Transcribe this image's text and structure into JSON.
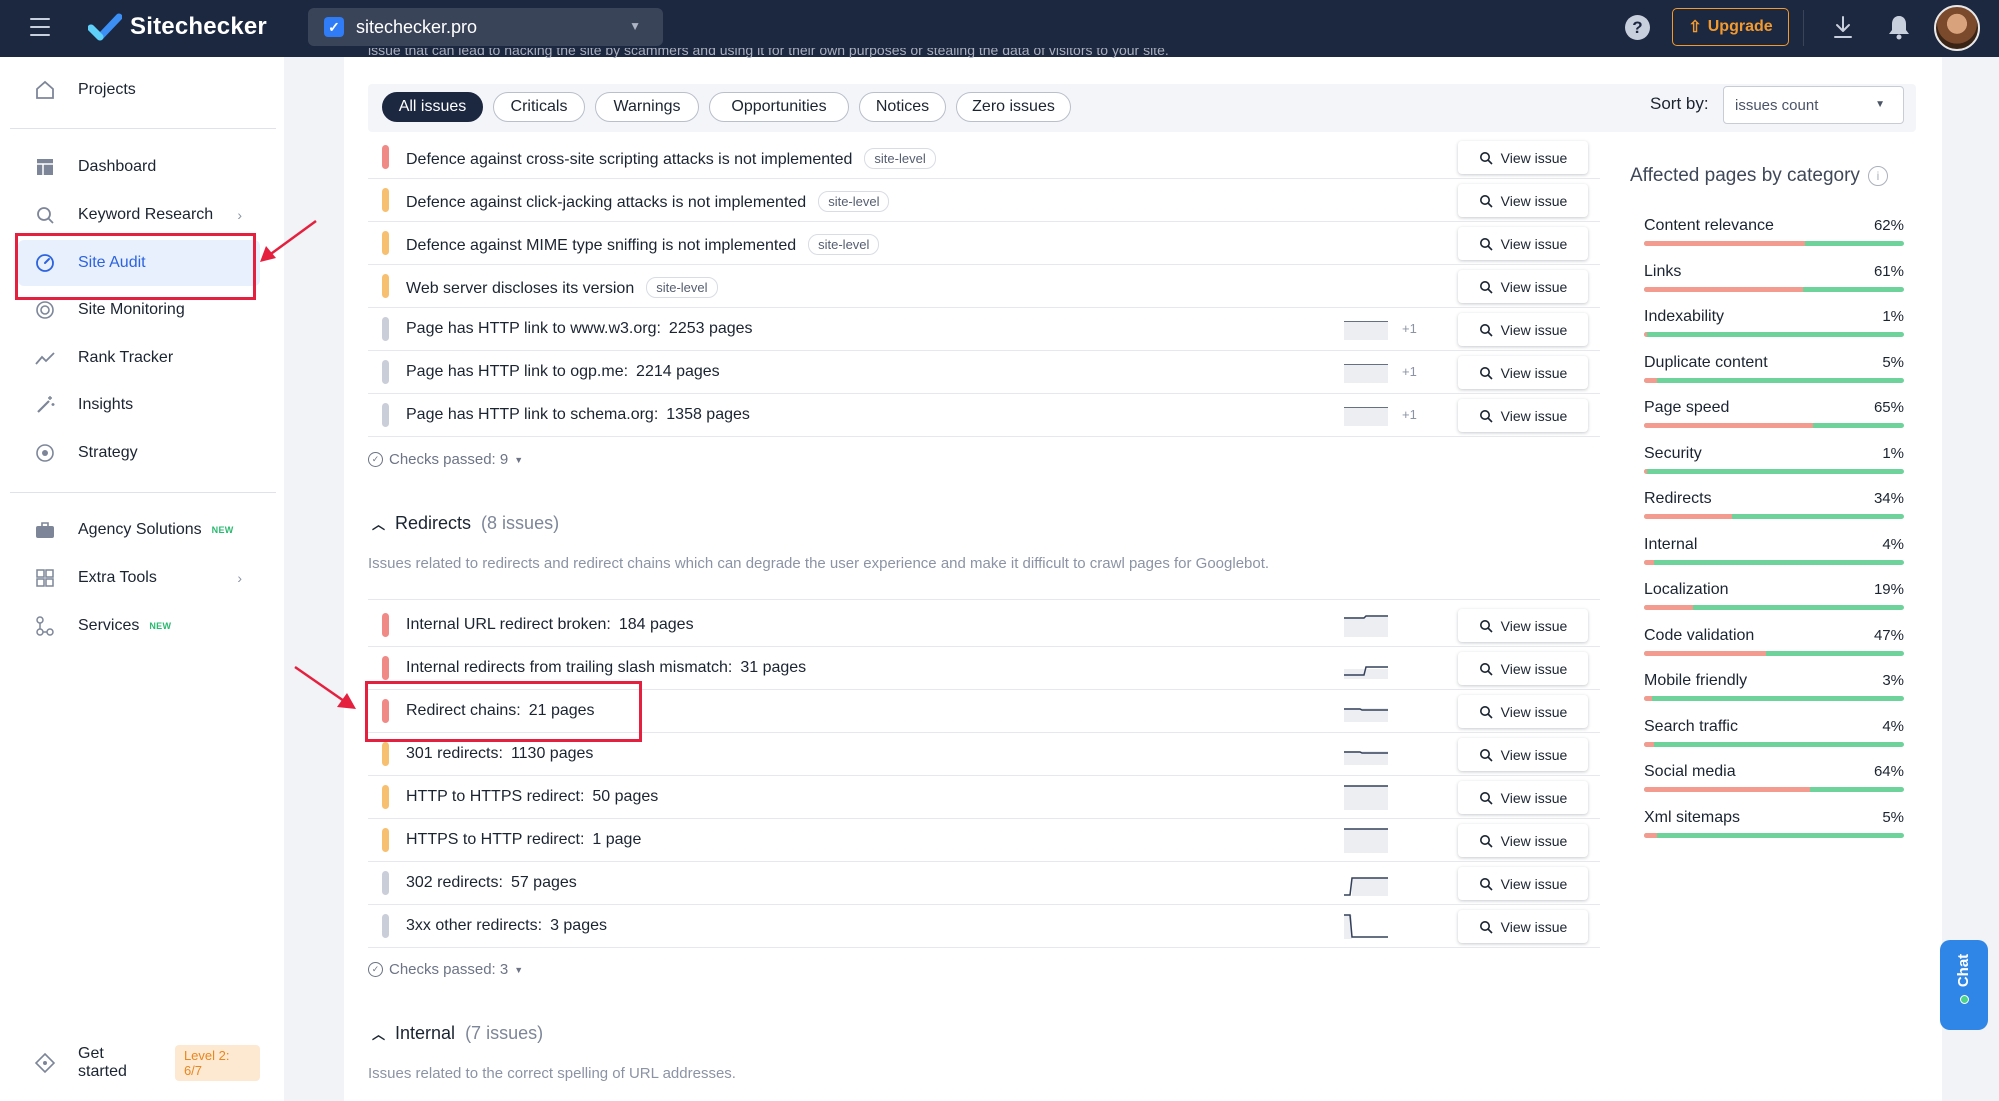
{
  "app": {
    "name": "Sitechecker",
    "project": "sitechecker.pro",
    "upgrade_label": "Upgrade"
  },
  "sidebar": {
    "items": [
      {
        "label": "Projects",
        "icon": "home-icon"
      },
      {
        "label": "Dashboard",
        "icon": "dashboard-icon"
      },
      {
        "label": "Keyword Research",
        "icon": "keyword-icon"
      },
      {
        "label": "Site Audit",
        "icon": "audit-icon"
      },
      {
        "label": "Site Monitoring",
        "icon": "monitoring-icon"
      },
      {
        "label": "Rank Tracker",
        "icon": "rank-icon"
      },
      {
        "label": "Insights",
        "icon": "wand-icon"
      },
      {
        "label": "Strategy",
        "icon": "target-icon"
      },
      {
        "label": "Agency Solutions",
        "icon": "briefcase-icon",
        "badge": "NEW"
      },
      {
        "label": "Extra Tools",
        "icon": "grid-icon"
      },
      {
        "label": "Services",
        "icon": "services-icon",
        "badge": "NEW"
      }
    ],
    "get_started": "Get started",
    "level": "Level 2: 6/7"
  },
  "main": {
    "clipped_text": "issue that can lead to hacking the site by scammers and using it for their own purposes or stealing the data of visitors to your site.",
    "filters": [
      "All issues",
      "Criticals",
      "Warnings",
      "Opportunities",
      "Notices",
      "Zero issues"
    ],
    "sort_label": "Sort by:",
    "sort_value": "issues count",
    "view_label": "View issue",
    "security_issues": [
      {
        "title": "Defence against cross-site scripting attacks is not implemented",
        "tag": "site-level",
        "severity": "red"
      },
      {
        "title": "Defence against click-jacking attacks is not implemented",
        "tag": "site-level",
        "severity": "orange"
      },
      {
        "title": "Defence against MIME type sniffing is not implemented",
        "tag": "site-level",
        "severity": "orange"
      },
      {
        "title": "Web server discloses its version",
        "tag": "site-level",
        "severity": "orange"
      },
      {
        "title": "Page has HTTP link to www.w3.org:",
        "count": "2253 pages",
        "severity": "gray",
        "plus": "+1"
      },
      {
        "title": "Page has HTTP link to ogp.me:",
        "count": "2214 pages",
        "severity": "gray",
        "plus": "+1"
      },
      {
        "title": "Page has HTTP link to schema.org:",
        "count": "1358 pages",
        "severity": "gray",
        "plus": "+1"
      }
    ],
    "checks_passed_1": "Checks passed: 9",
    "redirects": {
      "title": "Redirects",
      "count": "(8 issues)",
      "desc": "Issues related to redirects and redirect chains which can degrade the user experience and make it difficult to crawl pages for Googlebot.",
      "issues": [
        {
          "title": "Internal URL redirect broken:",
          "count": "184 pages",
          "severity": "red"
        },
        {
          "title": "Internal redirects from trailing slash mismatch:",
          "count": "31 pages",
          "severity": "red"
        },
        {
          "title": "Redirect chains:",
          "count": "21 pages",
          "severity": "red"
        },
        {
          "title": "301 redirects:",
          "count": "1130 pages",
          "severity": "orange"
        },
        {
          "title": "HTTP to HTTPS redirect:",
          "count": "50 pages",
          "severity": "orange"
        },
        {
          "title": "HTTPS to HTTP redirect:",
          "count": "1 page",
          "severity": "orange"
        },
        {
          "title": "302 redirects:",
          "count": "57 pages",
          "severity": "gray"
        },
        {
          "title": "3xx other redirects:",
          "count": "3 pages",
          "severity": "gray"
        }
      ]
    },
    "checks_passed_2": "Checks passed: 3",
    "internal": {
      "title": "Internal",
      "count": "(7 issues)",
      "desc": "Issues related to the correct spelling of URL addresses."
    }
  },
  "categories": {
    "title": "Affected pages by category",
    "items": [
      {
        "name": "Content relevance",
        "pct": "62%",
        "value": 62
      },
      {
        "name": "Links",
        "pct": "61%",
        "value": 61
      },
      {
        "name": "Indexability",
        "pct": "1%",
        "value": 1
      },
      {
        "name": "Duplicate content",
        "pct": "5%",
        "value": 5
      },
      {
        "name": "Page speed",
        "pct": "65%",
        "value": 65
      },
      {
        "name": "Security",
        "pct": "1%",
        "value": 1
      },
      {
        "name": "Redirects",
        "pct": "34%",
        "value": 34
      },
      {
        "name": "Internal",
        "pct": "4%",
        "value": 4
      },
      {
        "name": "Localization",
        "pct": "19%",
        "value": 19
      },
      {
        "name": "Code validation",
        "pct": "47%",
        "value": 47
      },
      {
        "name": "Mobile friendly",
        "pct": "3%",
        "value": 3
      },
      {
        "name": "Search traffic",
        "pct": "4%",
        "value": 4
      },
      {
        "name": "Social media",
        "pct": "64%",
        "value": 64
      },
      {
        "name": "Xml sitemaps",
        "pct": "5%",
        "value": 5
      }
    ]
  },
  "chat_label": "Chat",
  "colors": {
    "annotation": "#e5203f",
    "accent": "#2b63e0",
    "nav": "#1c2740"
  }
}
